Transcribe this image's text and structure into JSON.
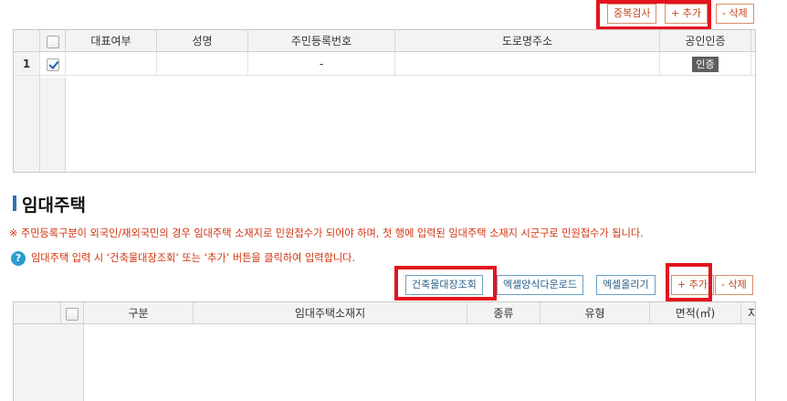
{
  "top_toolbar": {
    "dup_check_label": "중복검사",
    "add_label": "+ 추가",
    "delete_label": "- 삭제"
  },
  "owner_grid": {
    "columns": [
      "",
      "대표여부",
      "성명",
      "주민등록번호",
      "도로명주소",
      "공인인증"
    ],
    "rows": [
      {
        "rownum": "1",
        "checked": true,
        "representative": "",
        "name": "",
        "resident_no": "-",
        "address": "",
        "cert_label": "인증"
      }
    ]
  },
  "rental_section": {
    "title": "임대주택",
    "notice": "※ 주민등록구분이 외국인/재외국민의 경우 임대주택 소재지로 민원접수가 되어야 하며, 첫 행에 입력된 임대주택 소재지 시군구로 민원접수가 됩니다.",
    "help": "임대주택 입력 시 ‘건축물대장조회’ 또는 ‘추가’ 버튼을 클릭하여 입력합니다.",
    "help_icon_glyph": "?"
  },
  "rental_toolbar": {
    "building_lookup_label": "건축물대장조회",
    "excel_template_label": "엑셀양식다운로드",
    "excel_upload_label": "엑셀올리기",
    "add_label": "+ 추가",
    "delete_label": "- 삭제"
  },
  "rental_grid": {
    "columns": [
      "",
      "구분",
      "임대주택소재지",
      "종류",
      "유형",
      "면적(㎡)",
      "지"
    ]
  },
  "colors": {
    "highlight": "#e3141f",
    "accent_blue": "#2f73b7",
    "notice_red": "#d3320e"
  }
}
